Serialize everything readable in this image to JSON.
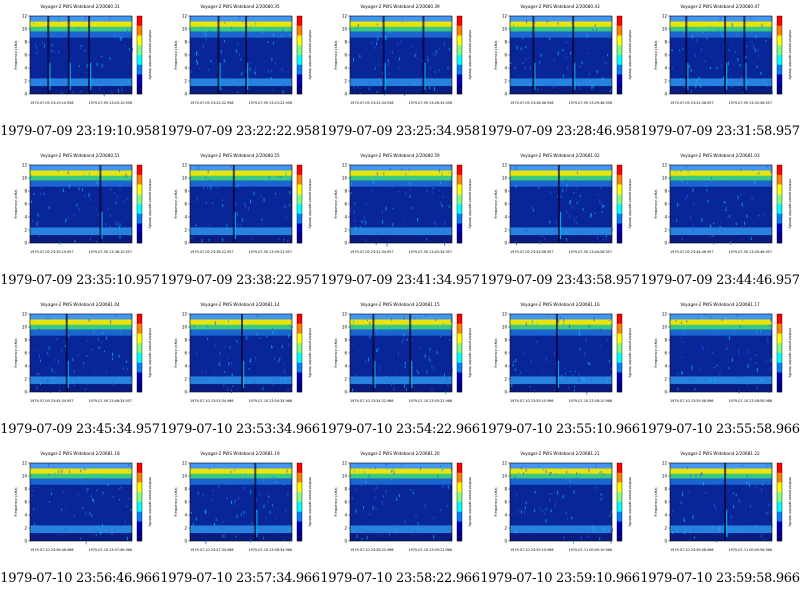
{
  "instrument_title": "Voyager-2 PWS Wideband",
  "y_axis_label": "Frequency (kHz)",
  "colorbar_label": "relative power spectral density",
  "freq_ticks": [
    "0",
    "2",
    "4",
    "6",
    "8",
    "10",
    "12"
  ],
  "colors": {
    "background": "#ffffff",
    "low": "#000080",
    "mid": "#00c0ff",
    "high": "#ffff00",
    "peak": "#ff0000"
  },
  "panels": [
    {
      "id": "2/20680.31",
      "caption": "1979-07-09 23:19:10.958",
      "date_start": "1979-07-09",
      "start_time": "23:19:10.958",
      "date_end": "1979-07-09",
      "end_time": "23:20:10.958",
      "bursts": [
        0.17,
        0.37,
        0.57
      ]
    },
    {
      "id": "2/20680.35",
      "caption": "1979-07-09 23:22:22.958",
      "date_start": "1979-07-09",
      "start_time": "23:22:22.958",
      "date_end": "1979-07-09",
      "end_time": "23:23:22.958",
      "bursts": [
        0.27,
        0.54
      ]
    },
    {
      "id": "2/20680.39",
      "caption": "1979-07-09 23:25:34.958",
      "date_start": "1979-07-09",
      "start_time": "23:25:34.958",
      "date_end": "1979-07-09",
      "end_time": "23:26:34.958",
      "bursts": [
        0.32,
        0.71
      ]
    },
    {
      "id": "2/20680.43",
      "caption": "1979-07-09 23:28:46.958",
      "date_start": "1979-07-09",
      "start_time": "23:28:46.958",
      "date_end": "1979-07-09",
      "end_time": "23:29:46.958",
      "bursts": [
        0.22,
        0.61
      ]
    },
    {
      "id": "2/20680.47",
      "caption": "1979-07-09 23:31:58.957",
      "date_start": "1979-07-09",
      "start_time": "23:31:58.957",
      "date_end": "1979-07-09",
      "end_time": "23:32:58.957",
      "bursts": [
        0.15,
        0.53,
        0.72
      ]
    },
    {
      "id": "2/20680.51",
      "caption": "1979-07-09 23:35:10.957",
      "date_start": "1979-07-09",
      "start_time": "23:35:10.957",
      "date_end": "1979-07-09",
      "end_time": "23:36:10.957",
      "bursts": [
        0.68
      ]
    },
    {
      "id": "2/20680.55",
      "caption": "1979-07-09 23:38:22.957",
      "date_start": "1979-07-09",
      "start_time": "23:38:22.957",
      "date_end": "1979-07-09",
      "end_time": "23:39:22.957",
      "bursts": [
        0.42
      ]
    },
    {
      "id": "2/20680.59",
      "caption": "1979-07-09 23:41:34.957",
      "date_start": "1979-07-09",
      "start_time": "23:41:34.957",
      "date_end": "1979-07-09",
      "end_time": "23:42:34.957",
      "bursts": []
    },
    {
      "id": "2/20681.02",
      "caption": "1979-07-09 23:43:58.957",
      "date_start": "1979-07-09",
      "start_time": "23:43:58.957",
      "date_end": "1979-07-09",
      "end_time": "23:44:58.957",
      "bursts": [
        0.47
      ]
    },
    {
      "id": "2/20681.03",
      "caption": "1979-07-09 23:44:46.957",
      "date_start": "1979-07-09",
      "start_time": "23:44:46.957",
      "date_end": "1979-07-09",
      "end_time": "23:45:46.957",
      "bursts": []
    },
    {
      "id": "2/20681.04",
      "caption": "1979-07-09 23:45:34.957",
      "date_start": "1979-07-09",
      "start_time": "23:45:34.957",
      "date_end": "1979-07-09",
      "end_time": "23:46:34.957",
      "bursts": [
        0.35
      ]
    },
    {
      "id": "2/20681.14",
      "caption": "1979-07-10 23:53:34.966",
      "date_start": "1979-07-10",
      "start_time": "23:53:34.966",
      "date_end": "1979-07-10",
      "end_time": "23:54:34.966",
      "bursts": [
        0.5
      ]
    },
    {
      "id": "2/20681.15",
      "caption": "1979-07-10 23:54:22.966",
      "date_start": "1979-07-10",
      "start_time": "23:54:22.966",
      "date_end": "1979-07-10",
      "end_time": "23:55:22.966",
      "bursts": [
        0.22,
        0.58
      ]
    },
    {
      "id": "2/20681.16",
      "caption": "1979-07-10 23:55:10.966",
      "date_start": "1979-07-10",
      "start_time": "23:55:10.966",
      "date_end": "1979-07-10",
      "end_time": "23:56:10.966",
      "bursts": [
        0.45
      ]
    },
    {
      "id": "2/20681.17",
      "caption": "1979-07-10 23:55:58.966",
      "date_start": "1979-07-10",
      "start_time": "23:55:58.966",
      "date_end": "1979-07-10",
      "end_time": "23:56:58.966",
      "bursts": []
    },
    {
      "id": "2/20681.18",
      "caption": "1979-07-10 23:56:46.966",
      "date_start": "1979-07-10",
      "start_time": "23:56:46.966",
      "date_end": "1979-07-10",
      "end_time": "23:57:46.966",
      "bursts": []
    },
    {
      "id": "2/20681.19",
      "caption": "1979-07-10 23:57:34.966",
      "date_start": "1979-07-10",
      "start_time": "23:57:34.966",
      "date_end": "1979-07-10",
      "end_time": "23:58:34.966",
      "bursts": [
        0.63
      ]
    },
    {
      "id": "2/20681.20",
      "caption": "1979-07-10 23:58:22.966",
      "date_start": "1979-07-10",
      "start_time": "23:58:22.966",
      "date_end": "1979-07-10",
      "end_time": "23:59:22.966",
      "bursts": []
    },
    {
      "id": "2/20681.21",
      "caption": "1979-07-10 23:59:10.966",
      "date_start": "1979-07-10",
      "start_time": "23:59:10.966",
      "date_end": "1979-07-11",
      "end_time": "00:00:10.966",
      "bursts": []
    },
    {
      "id": "2/20681.22",
      "caption": "1979-07-10 23:59:58.966",
      "date_start": "1979-07-10",
      "start_time": "23:59:58.966",
      "date_end": "1979-07-11",
      "end_time": "00:00:58.966",
      "bursts": [
        0.53
      ]
    }
  ]
}
